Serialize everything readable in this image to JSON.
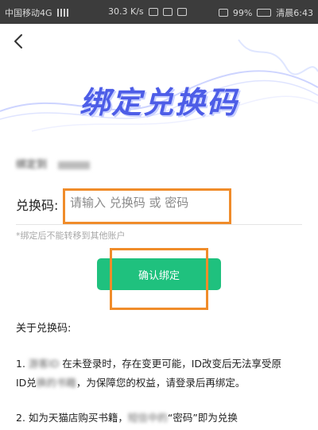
{
  "status_bar": {
    "carrier": "中国移动4G",
    "speed": "30.3 K/s",
    "battery": "99%",
    "time": "清晨6:43"
  },
  "header": {
    "back_icon": "chevron-left-icon",
    "banner_title": "绑定兑换码"
  },
  "account": {
    "label_blurred": "绑定到"
  },
  "form": {
    "code_label": "兑换码:",
    "code_placeholder": "请输入 兑换码 或 密码",
    "hint": "*绑定后不能转移到其他账户",
    "confirm_label": "确认绑定"
  },
  "about": {
    "title": "关于兑换码:",
    "p1_line1_prefix": "1.",
    "p1_line1_mid": "在未登录时，存在变更可能，ID改变后无法享受原",
    "p1_line2_prefix": "ID兑",
    "p1_line2_mid": "，为保障您的权益，请登录后再绑定。",
    "p2_text": "2. 如为天猫店购买书籍，",
    "p2_tail": "“密码”即为兑换"
  },
  "colors": {
    "accent_green": "#1fc17e",
    "banner_blue": "#4d5de7",
    "highlight_orange": "#f08c2a"
  }
}
